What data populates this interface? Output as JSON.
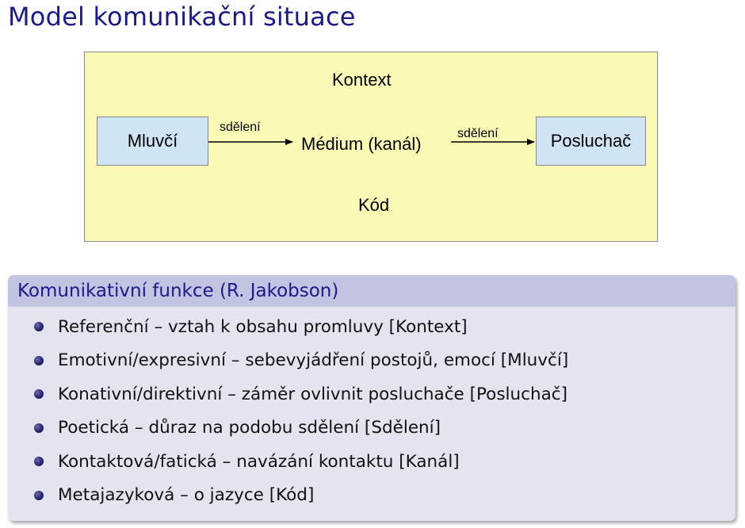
{
  "page": {
    "title": "Model komunikační situace"
  },
  "diagram": {
    "context_label": "Kontext",
    "code_label": "Kód",
    "speaker": "Mluvčí",
    "medium": "Médium (kanál)",
    "listener": "Posluchač",
    "message_left": "sdělení",
    "message_right": "sdělení",
    "colors": {
      "background": "#fafab4",
      "box_fill": "#cfe5f3",
      "border": "#8a8a8a"
    }
  },
  "block": {
    "title": "Komunikativní funkce (R. Jakobson)",
    "items": [
      "Referenční – vztah k obsahu promluvy [Kontext]",
      "Emotivní/expresivní – sebevyjádření postojů, emocí [Mluvčí]",
      "Konativní/direktivní – záměr ovlivnit posluchače [Posluchač]",
      "Poetická – důraz na podobu sdělení [Sdělení]",
      "Kontaktová/fatická – navázání kontaktu [Kanál]",
      "Metajazyková – o jazyce [Kód]"
    ],
    "colors": {
      "title": "#1a1a8c",
      "header": "#c3c3e2",
      "body": "#e4e4f1"
    }
  }
}
